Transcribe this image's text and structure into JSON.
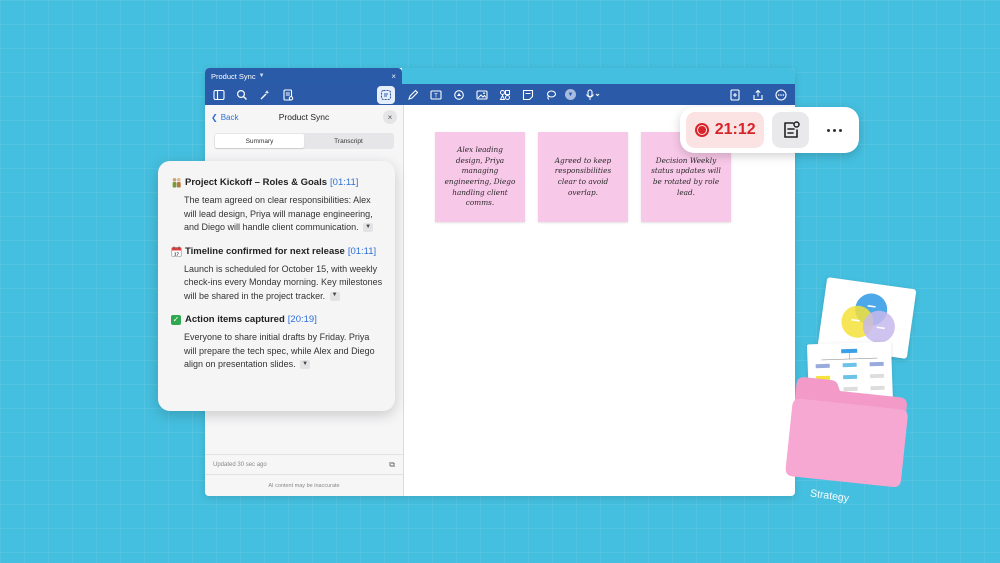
{
  "window": {
    "title": "Product Sync",
    "close_glyph": "×"
  },
  "toolbar": {
    "left_icons": [
      "sidebar-icon",
      "search-icon",
      "magic-icon",
      "document-icon"
    ],
    "active_icon": "meeting-notes-icon",
    "mid_icons": [
      "pen-icon",
      "text-box-icon",
      "shapes-icon",
      "image-icon",
      "elements-icon",
      "sticky-note-icon",
      "lasso-icon",
      "more-dropdown-icon",
      "microphone-icon"
    ],
    "right_icons": [
      "add-page-icon",
      "share-icon",
      "more-icon"
    ]
  },
  "sidebar": {
    "back_label": "Back",
    "title": "Product Sync",
    "tabs": [
      "Summary",
      "Transcript"
    ],
    "selected_tab": "Summary",
    "updated_text": "Updated 30 sec ago",
    "disclaimer": "AI content may be inaccurate"
  },
  "summary": {
    "sections": [
      {
        "emoji": "people-icon",
        "title": "Project Kickoff – Roles & Goals",
        "timestamp": "[01:11]",
        "body": "The team agreed on clear responsibilities: Alex will lead design, Priya will manage engineering, and Diego will handle client communication."
      },
      {
        "emoji": "calendar-icon",
        "title": "Timeline confirmed for next release",
        "timestamp": "[01:11]",
        "body": "Launch is scheduled for October 15, with weekly check-ins every Monday morning. Key milestones will be shared in the project tracker."
      },
      {
        "emoji": "checkmark-icon",
        "title": "Action items captured",
        "timestamp": "[20:19]",
        "body": "Everyone to share initial drafts by Friday. Priya will prepare the tech spec, while Alex and Diego align on presentation slides."
      }
    ]
  },
  "stickies": [
    {
      "text": "Alex leading design, Priya managing engineering, Diego handling client comms."
    },
    {
      "text": "Agreed to keep responsibilities clear to avoid overlap."
    },
    {
      "text": "Decision Weekly status updates will be rotated by role lead."
    }
  ],
  "recording": {
    "timer": "21:12",
    "color": "#d8232a"
  },
  "folder": {
    "label": "Strategy",
    "color": "#f49ac9"
  },
  "colors": {
    "background": "#45bfdf",
    "toolbar": "#2b5ba8",
    "accent_link": "#2f6fd6",
    "sticky": "#f8c8e8"
  }
}
